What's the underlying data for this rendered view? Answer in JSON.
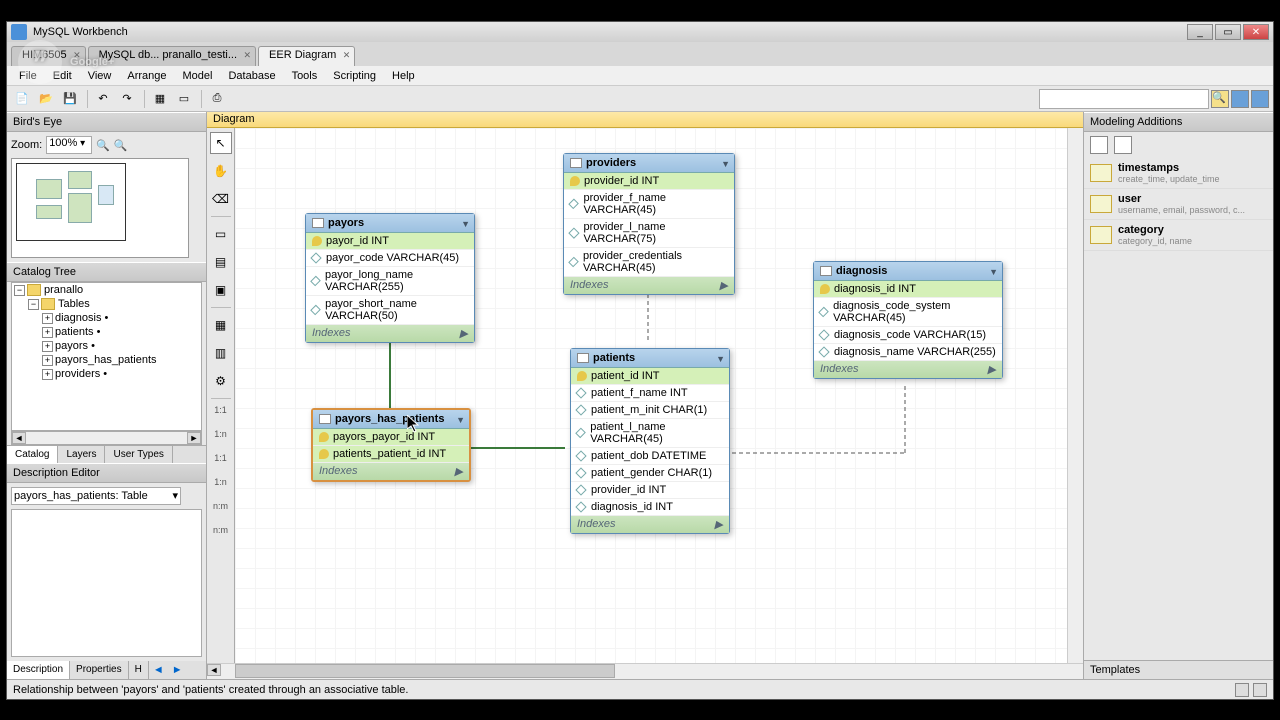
{
  "titlebar": {
    "app": "MySQL Workbench"
  },
  "docTabs": [
    {
      "label": "HIM6505"
    },
    {
      "label": "MySQL db... pranallo_testi..."
    },
    {
      "label": "EER Diagram",
      "active": true
    }
  ],
  "menus": [
    "File",
    "Edit",
    "View",
    "Arrange",
    "Model",
    "Database",
    "Tools",
    "Scripting",
    "Help"
  ],
  "left": {
    "birdsEye": "Bird's Eye",
    "zoomLabel": "Zoom:",
    "zoomValue": "100%",
    "catalog": "Catalog Tree",
    "tree": {
      "schema": "pranallo",
      "tables_label": "Tables",
      "tables": [
        "diagnosis •",
        "patients •",
        "payors •",
        "payors_has_patients",
        "providers •"
      ]
    },
    "tabs": [
      "Catalog",
      "Layers",
      "User Types"
    ],
    "descEditor": "Description Editor",
    "descSelect": "payors_has_patients: Table",
    "bottomTabs": [
      "Description",
      "Properties",
      "H"
    ]
  },
  "diagram": {
    "header": "Diagram",
    "relLabels": [
      "1:1",
      "1:n",
      "1:1",
      "1:n",
      "n:m",
      "n:m"
    ]
  },
  "entities": {
    "payors": {
      "title": "payors",
      "cols": [
        {
          "pk": true,
          "txt": "payor_id INT"
        },
        {
          "pk": false,
          "txt": "payor_code VARCHAR(45)"
        },
        {
          "pk": false,
          "txt": "payor_long_name VARCHAR(255)"
        },
        {
          "pk": false,
          "txt": "payor_short_name VARCHAR(50)"
        }
      ],
      "indexes": "Indexes"
    },
    "providers": {
      "title": "providers",
      "cols": [
        {
          "pk": true,
          "txt": "provider_id INT"
        },
        {
          "pk": false,
          "txt": "provider_f_name VARCHAR(45)"
        },
        {
          "pk": false,
          "txt": "provider_l_name VARCHAR(75)"
        },
        {
          "pk": false,
          "txt": "provider_credentials VARCHAR(45)"
        }
      ],
      "indexes": "Indexes"
    },
    "diagnosis": {
      "title": "diagnosis",
      "cols": [
        {
          "pk": true,
          "txt": "diagnosis_id INT"
        },
        {
          "pk": false,
          "txt": "diagnosis_code_system VARCHAR(45)"
        },
        {
          "pk": false,
          "txt": "diagnosis_code VARCHAR(15)"
        },
        {
          "pk": false,
          "txt": "diagnosis_name VARCHAR(255)"
        }
      ],
      "indexes": "Indexes"
    },
    "patients": {
      "title": "patients",
      "cols": [
        {
          "pk": true,
          "txt": "patient_id INT"
        },
        {
          "pk": false,
          "txt": "patient_f_name INT"
        },
        {
          "pk": false,
          "txt": "patient_m_init CHAR(1)"
        },
        {
          "pk": false,
          "txt": "patient_l_name VARCHAR(45)"
        },
        {
          "pk": false,
          "txt": "patient_dob DATETIME"
        },
        {
          "pk": false,
          "txt": "patient_gender CHAR(1)"
        },
        {
          "pk": false,
          "txt": "provider_id INT"
        },
        {
          "pk": false,
          "txt": "diagnosis_id INT"
        }
      ],
      "indexes": "Indexes"
    },
    "payors_has_patients": {
      "title": "payors_has_patients",
      "cols": [
        {
          "pk": true,
          "txt": "payors_payor_id INT"
        },
        {
          "pk": true,
          "txt": "patients_patient_id INT"
        }
      ],
      "indexes": "Indexes"
    }
  },
  "right": {
    "header": "Modeling Additions",
    "templates": [
      {
        "name": "timestamps",
        "desc": "create_time, update_time"
      },
      {
        "name": "user",
        "desc": "username, email, password, c..."
      },
      {
        "name": "category",
        "desc": "category_id, name"
      }
    ],
    "footer": "Templates"
  },
  "status": {
    "text": "Relationship between 'payors' and 'patients' created through an associative table."
  },
  "overlay": "Google+"
}
